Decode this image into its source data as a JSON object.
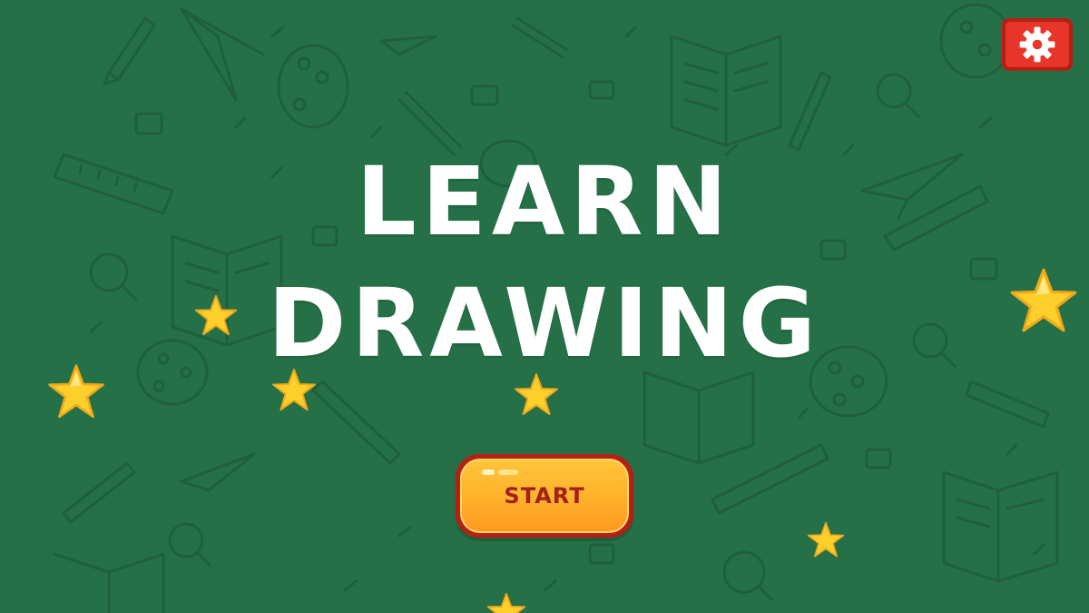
{
  "game": {
    "title_line_1": "LEARN",
    "title_line_2": "DRAWING",
    "start_label": "START"
  },
  "icons": {
    "settings": "gear-icon",
    "decor": "star-icon"
  },
  "colors": {
    "background": "#257047",
    "doodle": "#1f5f3c",
    "title": "#ffffff",
    "button_orange": "#ffb52e",
    "button_border": "#b51f14",
    "settings_red": "#e8352a",
    "star": "#ffd12b"
  }
}
